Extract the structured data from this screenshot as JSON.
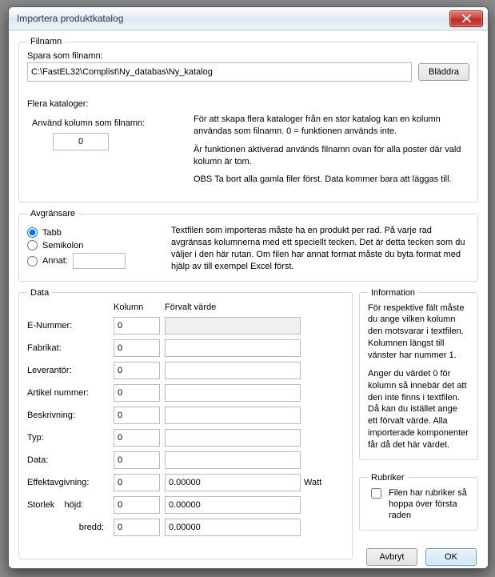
{
  "window": {
    "title": "Importera produktkatalog"
  },
  "filnamn": {
    "legend": "Filnamn",
    "save_as_label": "Spara som filnamn:",
    "path": "C:\\FastEL32\\Complist\\Ny_databas\\Ny_katalog",
    "browse_label": "Bläddra"
  },
  "flera": {
    "legend": "Flera kataloger:",
    "use_column_label": "Använd kolumn som filnamn:",
    "column_value": "0",
    "para1": "För att skapa flera kataloger från en stor katalog kan en kolumn användas som filnamn. 0 = funktionen används inte.",
    "para2": "Är funktionen aktiverad används filnamn ovan för alla poster där vald kolumn är tom.",
    "para3": "OBS Ta bort alla gamla filer först. Data kommer bara att läggas till."
  },
  "avgr": {
    "legend": "Avgränsare",
    "tabb": "Tabb",
    "semikolon": "Semikolon",
    "annat": "Annat:",
    "annat_value": "",
    "desc": "Textfilen som importeras måste ha en produkt per rad. På varje rad avgränsas kolumnerna med ett speciellt tecken. Det är detta tecken som du väljer i den här rutan. Om filen har annat format måste du byta format med hjälp av till exempel Excel först."
  },
  "data": {
    "legend": "Data",
    "hdr_col": "Kolumn",
    "hdr_val": "Förvalt värde",
    "rows": {
      "enummer": {
        "label": "E-Nummer:",
        "col": "0",
        "val": "",
        "readonly": true
      },
      "fabrikat": {
        "label": "Fabrikat:",
        "col": "0",
        "val": ""
      },
      "leverantor": {
        "label": "Leverantör:",
        "col": "0",
        "val": ""
      },
      "artikel": {
        "label": "Artikel nummer:",
        "col": "0",
        "val": ""
      },
      "beskr": {
        "label": "Beskrivning:",
        "col": "0",
        "val": ""
      },
      "typ": {
        "label": "Typ:",
        "col": "0",
        "val": ""
      },
      "data": {
        "label": "Data:",
        "col": "0",
        "val": ""
      },
      "effekt": {
        "label": "Effektavgivning:",
        "col": "0",
        "val": "0.00000",
        "unit": "Watt"
      },
      "hojd": {
        "label": "Storlek    höjd:",
        "col": "0",
        "val": "0.00000"
      },
      "bredd": {
        "label": "bredd:",
        "col": "0",
        "val": "0.00000"
      }
    }
  },
  "info": {
    "legend": "Information",
    "para1": "För respektive fält måste du ange vilken kolumn den motsvarar i textfilen. Kolumnen längst till vänster har nummer 1.",
    "para2": "Anger du värdet 0 för kolumn så innebär det att den inte finns i textfilen. Då kan du istället ange ett förvalt värde. Alla importerade komponenter får då det här värdet."
  },
  "rubr": {
    "legend": "Rubriker",
    "checkbox_label": "Filen har rubriker så hoppa över första raden"
  },
  "buttons": {
    "cancel": "Avbryt",
    "ok": "OK"
  }
}
